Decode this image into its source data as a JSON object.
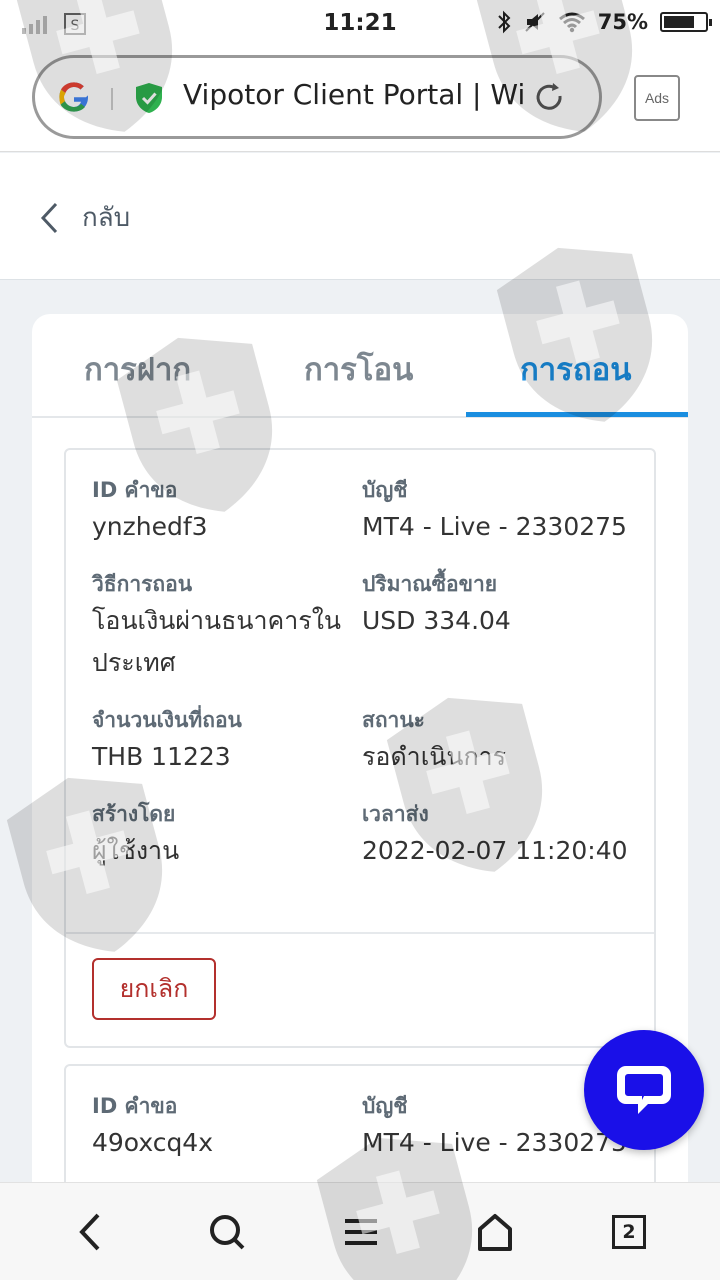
{
  "status_bar": {
    "time": "11:21",
    "battery": "75%",
    "battery_level": 0.75
  },
  "browser": {
    "url_title": "Vipotor Client Portal | Wi...",
    "ads_label": "Ads"
  },
  "header": {
    "back_label": "กลับ"
  },
  "tabs": [
    {
      "label": "การฝาก",
      "active": false
    },
    {
      "label": "การโอน",
      "active": false
    },
    {
      "label": "การถอน",
      "active": true
    }
  ],
  "transactions": [
    {
      "request_id_label": "ID คำขอ",
      "request_id": "ynzhedf3",
      "account_label": "บัญชี",
      "account": "MT4 - Live - 2330275",
      "method_label": "วิธีการถอน",
      "method": "โอนเงินผ่านธนาคารในประเทศ",
      "volume_label": "ปริมาณซื้อขาย",
      "volume": "USD 334.04",
      "amount_label": "จำนวนเงินที่ถอน",
      "amount": "THB 11223",
      "status_label": "สถานะ",
      "status": "รอดำเนินการ",
      "created_by_label": "สร้างโดย",
      "created_by": "ผู้ใช้งาน",
      "sent_time_label": "เวลาส่ง",
      "sent_time": "2022-02-07 11:20:40",
      "cancel_label": "ยกเลิก"
    },
    {
      "request_id_label": "ID คำขอ",
      "request_id": "49oxcq4x",
      "account_label": "บัญชี",
      "account": "MT4 - Live - 2330275"
    }
  ],
  "bottom_nav": {
    "tab_count": "2"
  },
  "colors": {
    "accent": "#1a8ee0",
    "cancel": "#b3302d",
    "chat": "#1a10e8"
  }
}
